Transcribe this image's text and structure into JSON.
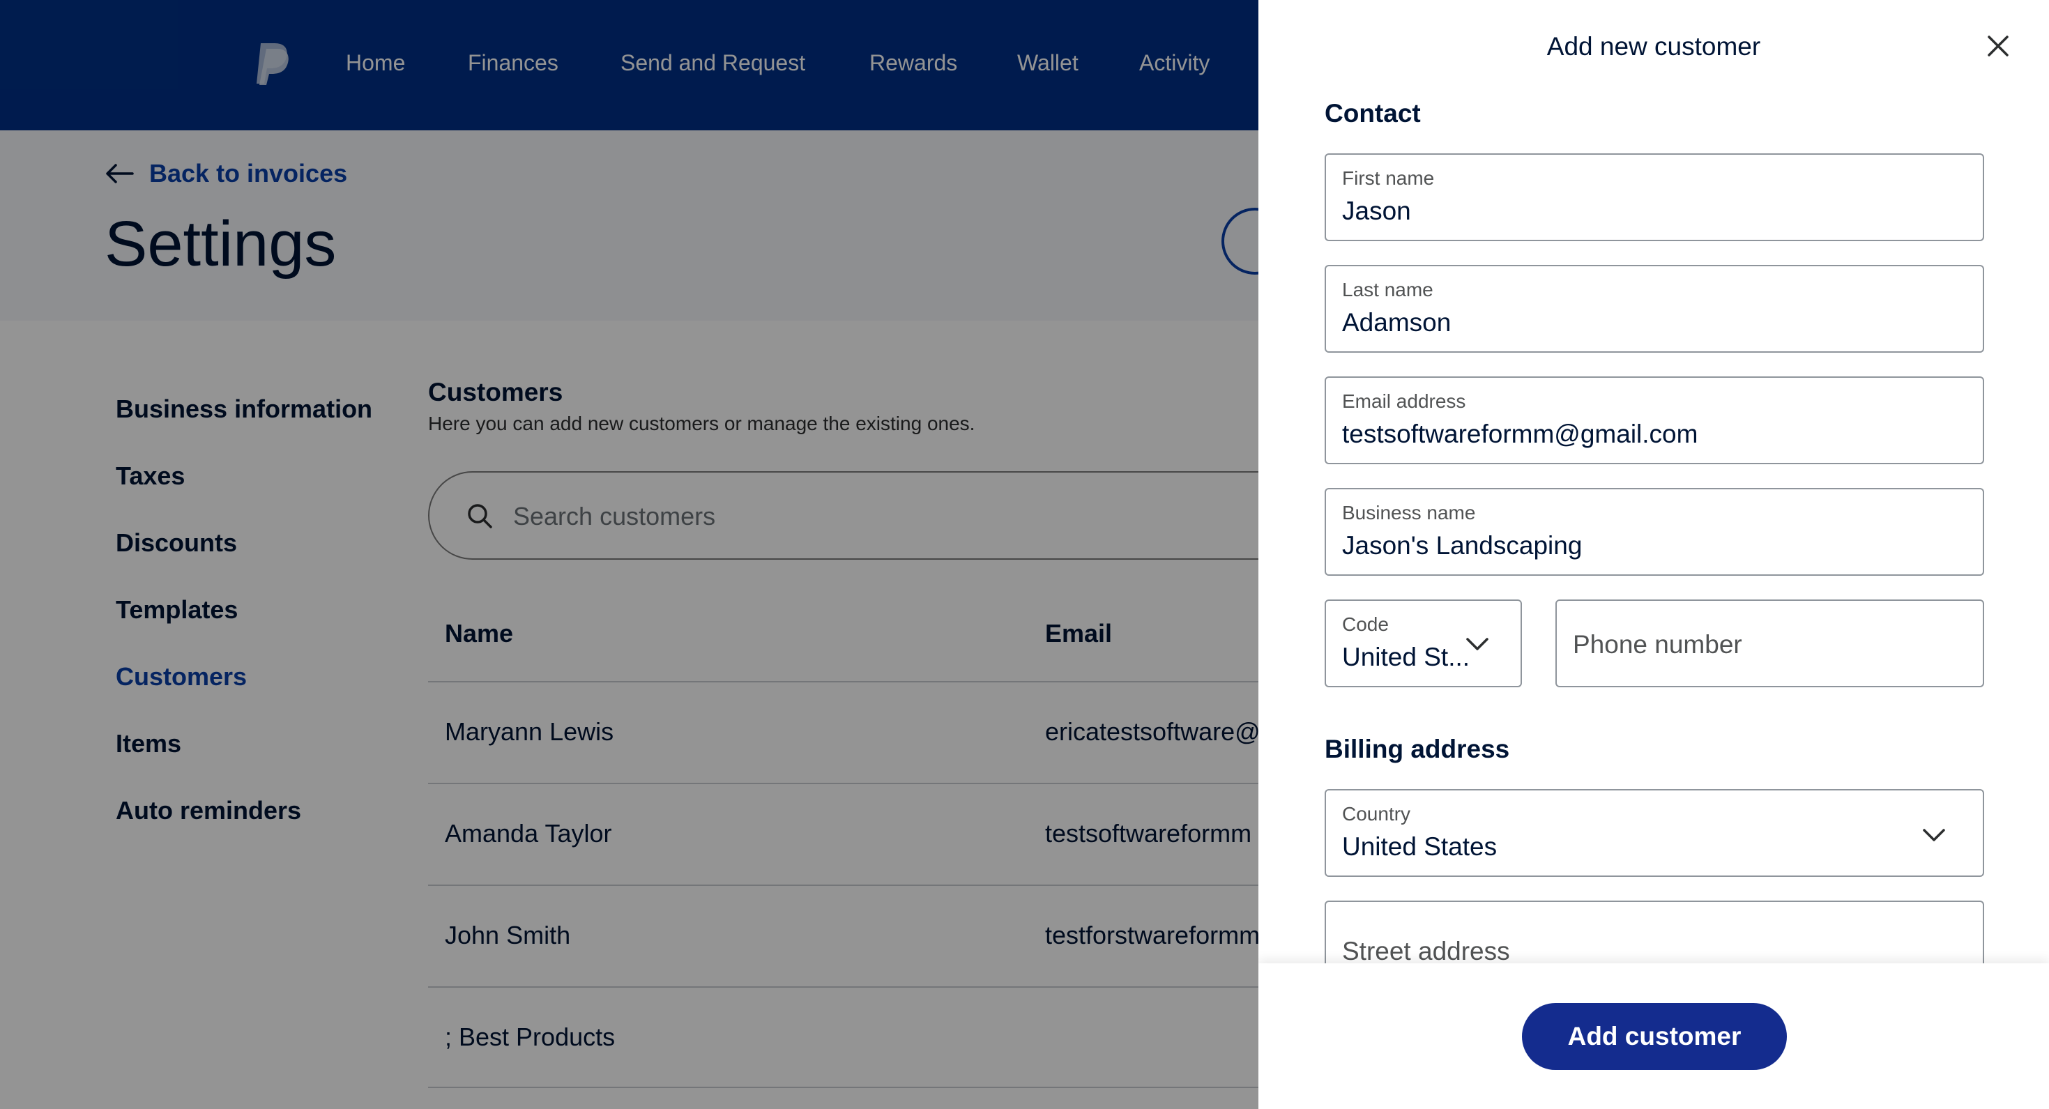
{
  "nav": {
    "items": [
      "Home",
      "Finances",
      "Send and Request",
      "Rewards",
      "Wallet",
      "Activity"
    ]
  },
  "header": {
    "back_label": "Back to invoices",
    "title": "Settings"
  },
  "sidebar": {
    "items": [
      {
        "label": "Business information"
      },
      {
        "label": "Taxes"
      },
      {
        "label": "Discounts"
      },
      {
        "label": "Templates"
      },
      {
        "label": "Customers",
        "active": true
      },
      {
        "label": "Items"
      },
      {
        "label": "Auto reminders"
      }
    ]
  },
  "customers": {
    "title": "Customers",
    "subtitle": "Here you can add new customers or manage the existing ones.",
    "search_placeholder": "Search customers",
    "columns": [
      "Name",
      "Email"
    ],
    "rows": [
      {
        "name": "Maryann Lewis",
        "email": "ericatestsoftware@"
      },
      {
        "name": "Amanda Taylor",
        "email": "testsoftwareformm"
      },
      {
        "name": "John Smith",
        "email": "testforstwareformm"
      },
      {
        "name": "; Best Products",
        "email": ""
      }
    ]
  },
  "drawer": {
    "title": "Add new customer",
    "contact_title": "Contact",
    "first_name": {
      "label": "First name",
      "value": "Jason"
    },
    "last_name": {
      "label": "Last name",
      "value": "Adamson"
    },
    "email": {
      "label": "Email address",
      "value": "testsoftwareformm@gmail.com"
    },
    "business": {
      "label": "Business name",
      "value": "Jason's Landscaping"
    },
    "code": {
      "label": "Code",
      "value": "United St..."
    },
    "phone": {
      "placeholder": "Phone number"
    },
    "billing_title": "Billing address",
    "country": {
      "label": "Country",
      "value": "United States"
    },
    "street": {
      "placeholder": "Street address"
    },
    "submit_label": "Add customer"
  },
  "colors": {
    "nav_bg": "#003087",
    "link": "#0a3ea8",
    "primary_button": "#142c8e",
    "text": "#001435"
  }
}
